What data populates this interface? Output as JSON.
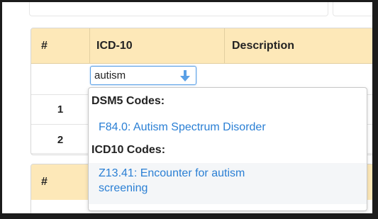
{
  "table": {
    "headers": {
      "num": "#",
      "icd10": "ICD-10",
      "description": "Description"
    },
    "rows": [
      {
        "num": "1"
      },
      {
        "num": "2"
      }
    ]
  },
  "search": {
    "value": "autism"
  },
  "dropdown": {
    "groups": [
      {
        "label": "DSM5 Codes:",
        "options": [
          "F84.0: Autism Spectrum Disorder"
        ]
      },
      {
        "label": "ICD10 Codes:",
        "options": [
          "Z13.41: Encounter for autism\nscreening"
        ]
      }
    ]
  },
  "table2": {
    "headers": {
      "num": "#"
    }
  },
  "colors": {
    "header_bg": "#fde8b8",
    "link": "#2a7fd4",
    "focus": "#5aa0e6"
  },
  "icons": {
    "dropdown_arrow": "arrow-down-icon"
  }
}
